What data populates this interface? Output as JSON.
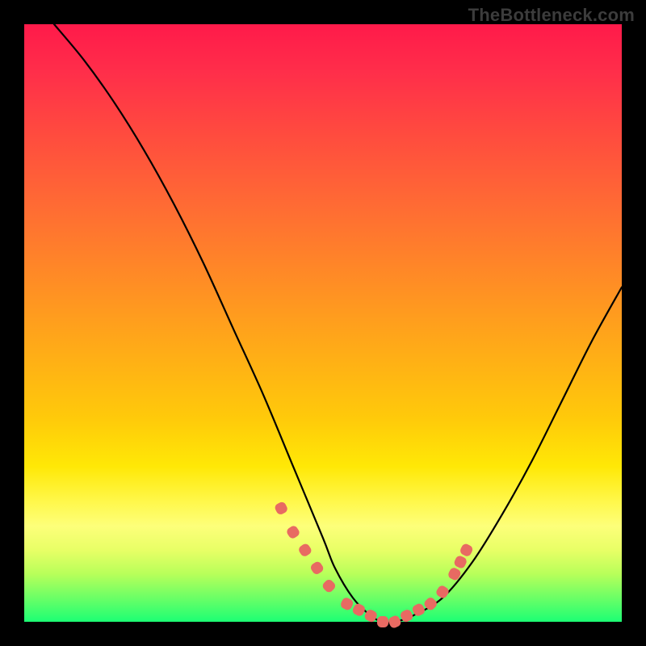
{
  "watermark": "TheBottleneck.com",
  "colors": {
    "frame_bg": "#000000",
    "curve_stroke": "#000000",
    "marker_fill": "#e86a62",
    "gradient_stops": [
      "#ff1a4a",
      "#ff8a26",
      "#ffe806",
      "#1cff74"
    ]
  },
  "chart_data": {
    "type": "line",
    "title": "",
    "xlabel": "",
    "ylabel": "",
    "xlim": [
      0,
      100
    ],
    "ylim": [
      0,
      100
    ],
    "grid": false,
    "legend": false,
    "annotations": [
      "TheBottleneck.com"
    ],
    "series": [
      {
        "name": "bottleneck-curve",
        "x": [
          5,
          10,
          15,
          20,
          25,
          30,
          35,
          40,
          45,
          50,
          52,
          55,
          58,
          60,
          62,
          65,
          70,
          75,
          80,
          85,
          90,
          95,
          100
        ],
        "y": [
          100,
          94,
          87,
          79,
          70,
          60,
          49,
          38,
          26,
          14,
          9,
          4,
          1,
          0,
          0,
          1,
          4,
          10,
          18,
          27,
          37,
          47,
          56
        ]
      }
    ],
    "markers": {
      "name": "highlighted-points",
      "x": [
        43,
        45,
        47,
        49,
        51,
        54,
        56,
        58,
        60,
        62,
        64,
        66,
        68,
        70,
        72,
        73,
        74
      ],
      "y": [
        19,
        15,
        12,
        9,
        6,
        3,
        2,
        1,
        0,
        0,
        1,
        2,
        3,
        5,
        8,
        10,
        12
      ]
    }
  }
}
